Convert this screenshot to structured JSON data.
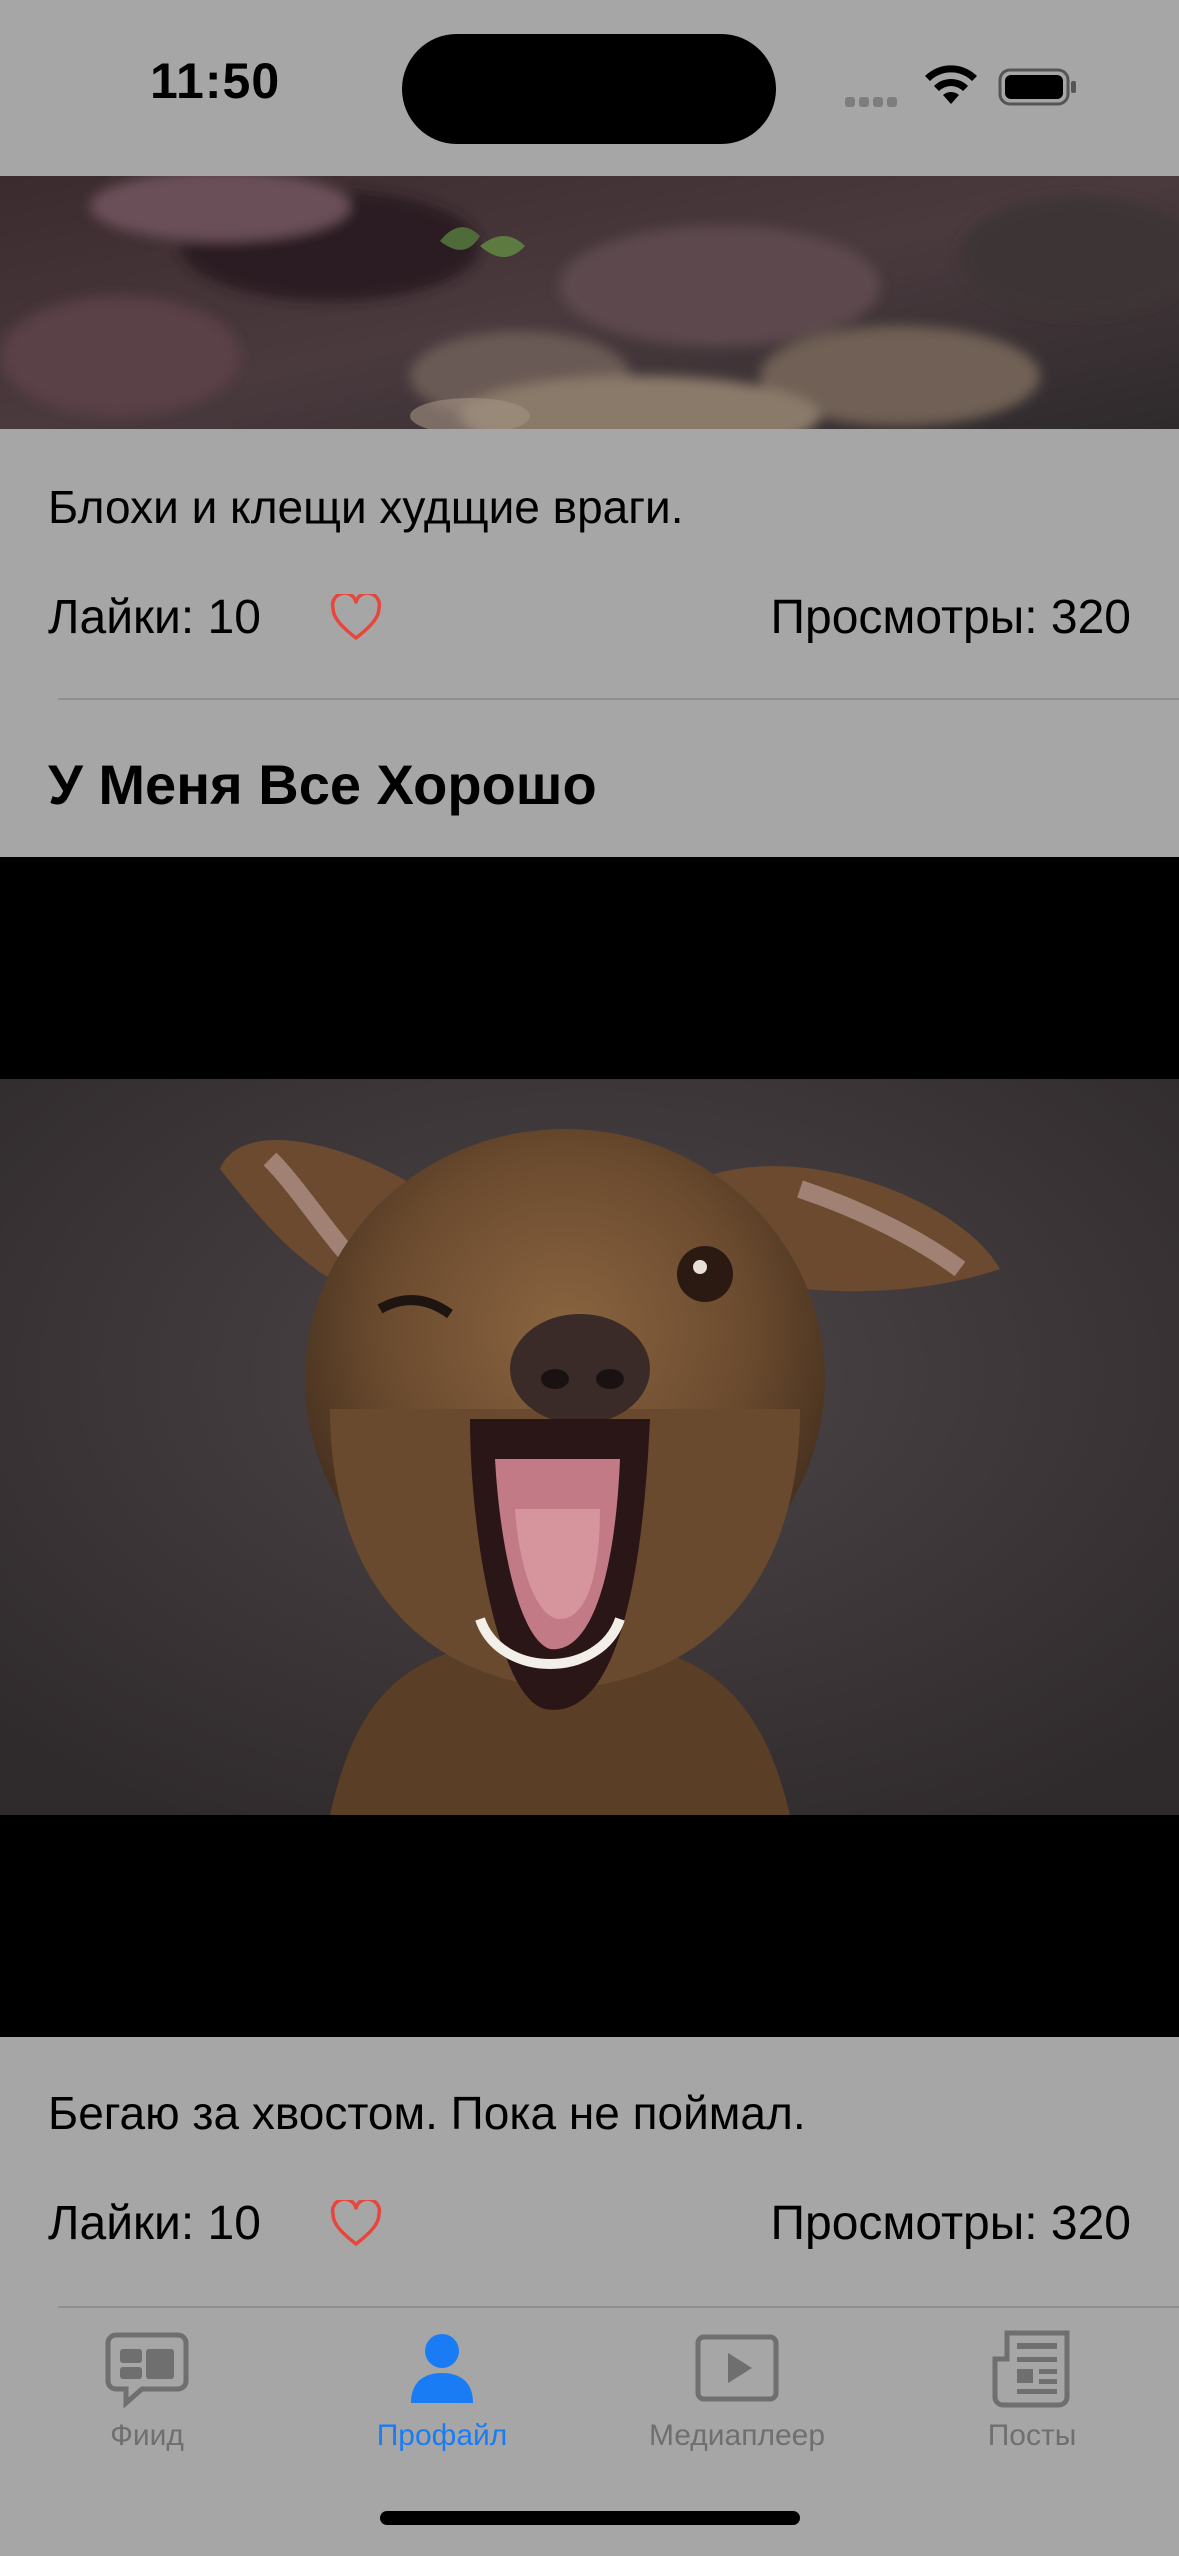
{
  "status_bar": {
    "time": "11:50"
  },
  "posts": [
    {
      "description": "Блохи и клещи худщие враги.",
      "likes_label": "Лайки: 10",
      "views_label": "Просмотры: 320"
    },
    {
      "title": "У Меня Все Хорошо",
      "description": "Бегаю за хвостом. Пока не поймал.",
      "likes_label": "Лайки: 10",
      "views_label": "Просмотры: 320"
    }
  ],
  "tabs": [
    {
      "label": "Фиид",
      "icon": "feed-icon",
      "active": false
    },
    {
      "label": "Профайл",
      "icon": "profile-icon",
      "active": true
    },
    {
      "label": "Медиаплеер",
      "icon": "media-player-icon",
      "active": false
    },
    {
      "label": "Посты",
      "icon": "posts-icon",
      "active": false
    }
  ],
  "colors": {
    "background": "#a6a6a6",
    "accent": "#1a7cf5",
    "heart": "#e8463c",
    "inactive_tab": "#6f6f6f"
  }
}
